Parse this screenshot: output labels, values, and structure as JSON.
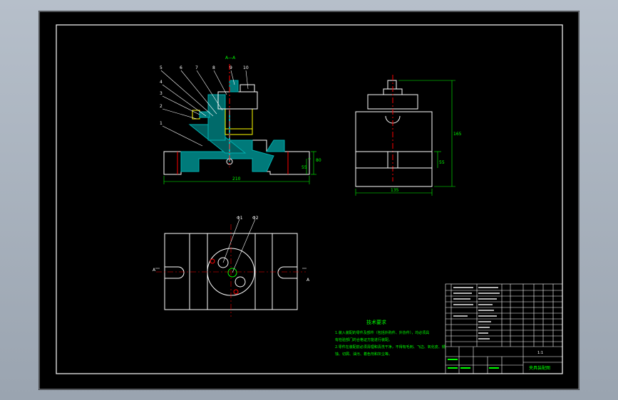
{
  "colors": {
    "background": "#000000",
    "outline": "#ffffff",
    "dimension": "#00ff00",
    "centerline": "#ff0000",
    "hatch": "#00b0b0",
    "part": "#ffff00",
    "frame": "#a0a6ae"
  },
  "front_view": {
    "part_numbers": [
      "5",
      "6",
      "7",
      "8",
      "9",
      "10",
      "4",
      "3",
      "2",
      "1"
    ],
    "top_label": "A—A",
    "width_dim": "210",
    "height_dims": [
      "80",
      "55"
    ]
  },
  "side_view": {
    "width_dim": "135",
    "height_dims": [
      "165",
      "55"
    ]
  },
  "top_view": {
    "hole_labels": [
      "Φ1",
      "Φ2"
    ],
    "section_labels": [
      "A",
      "A"
    ]
  },
  "tech_req": {
    "title": "技术要求",
    "lines": [
      "1.装入装配的零件及部件（包括外购件、外协件），均必须具",
      "有检验部门的合格证方能进行装配。",
      "2.零件在装配前必须清理和清洗干净，不得有毛刺、飞边、氧化皮、锈",
      "蚀、切屑、油污、着色剂和灰尘等。"
    ]
  },
  "title_block": {
    "drawing_name": "夹具装配图",
    "scale": "1:1"
  }
}
